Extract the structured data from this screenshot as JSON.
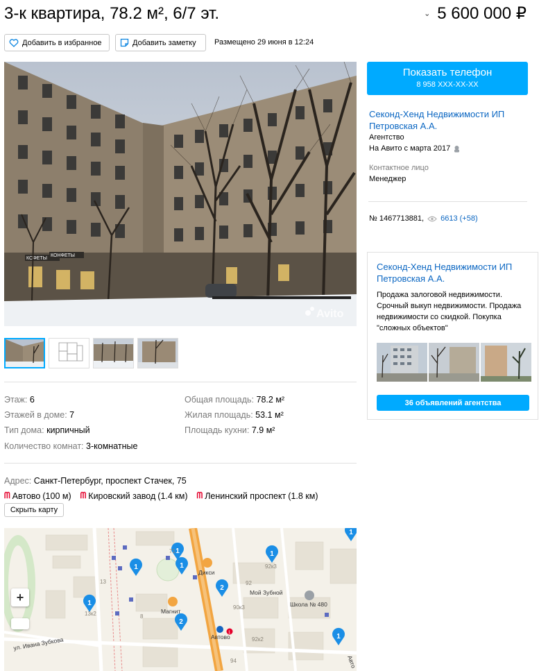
{
  "header": {
    "title": "3-к квартира, 78.2 м², 6/7 эт.",
    "price": "5 600 000 ₽",
    "price_chevron": "⌄"
  },
  "toolbar": {
    "favorite_label": "Добавить в избранное",
    "note_label": "Добавить заметку",
    "posted": "Размещено 29 июня в 12:24"
  },
  "gallery": {
    "watermark": "Avito",
    "main_photo_signs": [
      "КОФЕТЫ",
      "КОНФЕТЫ"
    ],
    "thumbnails": 4,
    "active_thumbnail": 1
  },
  "params": {
    "left": [
      {
        "k": "Этаж:",
        "v": "6"
      },
      {
        "k": "Этажей в доме:",
        "v": "7"
      },
      {
        "k": "Тип дома:",
        "v": "кирпичный"
      },
      {
        "k": "Количество комнат:",
        "v": "3-комнатные"
      }
    ],
    "right": [
      {
        "k": "Общая площадь:",
        "v": "78.2 м²"
      },
      {
        "k": "Жилая площадь:",
        "v": "53.1 м²"
      },
      {
        "k": "Площадь кухни:",
        "v": "7.9 м²"
      }
    ]
  },
  "address": {
    "label": "Адрес:",
    "value": "Санкт-Петербург, проспект Стачек, 75",
    "metro": [
      {
        "name": "Автово",
        "distance": "(100 м)"
      },
      {
        "name": "Кировский завод",
        "distance": "(1.4 км)"
      },
      {
        "name": "Ленинский проспект",
        "distance": "(1.8 км)"
      }
    ],
    "metro_symbol": "ᗰ",
    "hide_map_label": "Скрыть карту"
  },
  "map": {
    "zoom_in": "+",
    "street": "ул. Ивана Зубкова",
    "poi": {
      "dixy": "Дикси",
      "magnit": "Магнит",
      "dentist": "Мой Зубной",
      "school": "Школа № 480",
      "metro": "Автово",
      "metro_line": "1"
    },
    "house_numbers": [
      "71",
      "13",
      "13к2",
      "92к3",
      "92",
      "90к3",
      "92к2",
      "94",
      "8"
    ],
    "edge_label": "Авто",
    "pins": [
      "1",
      "1",
      "1",
      "1",
      "2",
      "1",
      "1",
      "2",
      "1"
    ]
  },
  "contact": {
    "show_phone": "Показать телефон",
    "phone_masked": "8 958 XXX-XX-XX",
    "seller_name": "Секонд-Хенд Недвижимости ИП Петровская А.А.",
    "seller_type": "Агентство",
    "since": "На Авито с марта 2017",
    "contact_person_label": "Контактное лицо",
    "contact_person": "Менеджер",
    "ad_number": "№ 1467713881,",
    "views": "6613 (+58)"
  },
  "agency": {
    "title": "Секонд-Хенд Недвижимости ИП Петровская А.А.",
    "description": "Продажа залоговой недвижимости. Срочный выкуп недвижимости. Продажа недвижимости со скидкой. Покупка \"сложных объектов\"",
    "ads_button": "36 объявлений агентства"
  },
  "colors": {
    "accent": "#00aaff",
    "link": "#0a66c2",
    "metro": "#e4002b",
    "map_pin": "#1a8ee6",
    "map_road": "#f2a541"
  }
}
